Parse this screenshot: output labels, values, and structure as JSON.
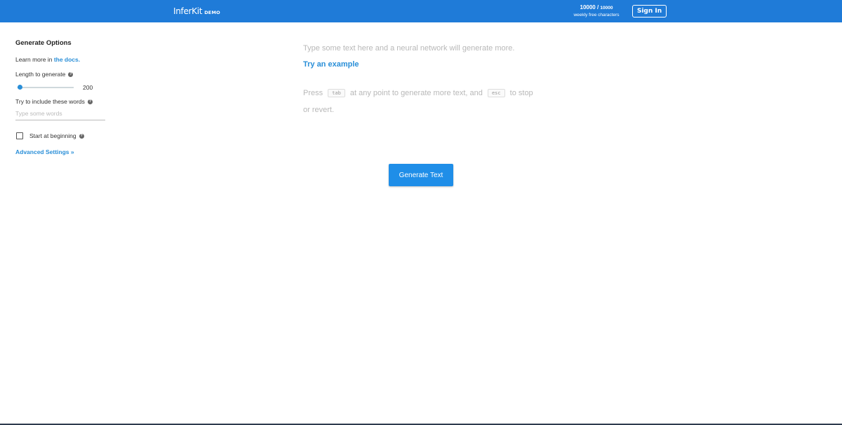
{
  "header": {
    "brand": "InferKit",
    "brand_tag": "DEMO",
    "quota_used": "10000",
    "quota_total": "10000",
    "quota_caption": "weekly free characters",
    "sign_in_label": "Sign In"
  },
  "sidebar": {
    "title": "Generate Options",
    "learn_prefix": "Learn more in ",
    "docs_link": "the docs.",
    "length_label": "Length to generate",
    "length_value": "200",
    "length_fraction": 0.05,
    "include_words_label": "Try to include these words",
    "include_words_placeholder": "Type some words",
    "start_at_beginning_label": "Start at beginning",
    "start_at_beginning_checked": false,
    "advanced_settings_label": "Advanced Settings »"
  },
  "editor": {
    "placeholder": "Type some text here and a neural network will generate more.",
    "try_example": "Try an example",
    "press_prefix": "Press",
    "tab_key": "tab",
    "press_middle": "at any point to generate more text, and",
    "esc_key": "esc",
    "press_suffix": "to stop",
    "press_line2": "or revert."
  },
  "actions": {
    "generate_label": "Generate Text"
  },
  "colors": {
    "header_bg": "#1f7bd8",
    "accent": "#2a8fd8",
    "button_bg": "#1f8ee8"
  },
  "icons": {
    "help": "help-icon"
  }
}
